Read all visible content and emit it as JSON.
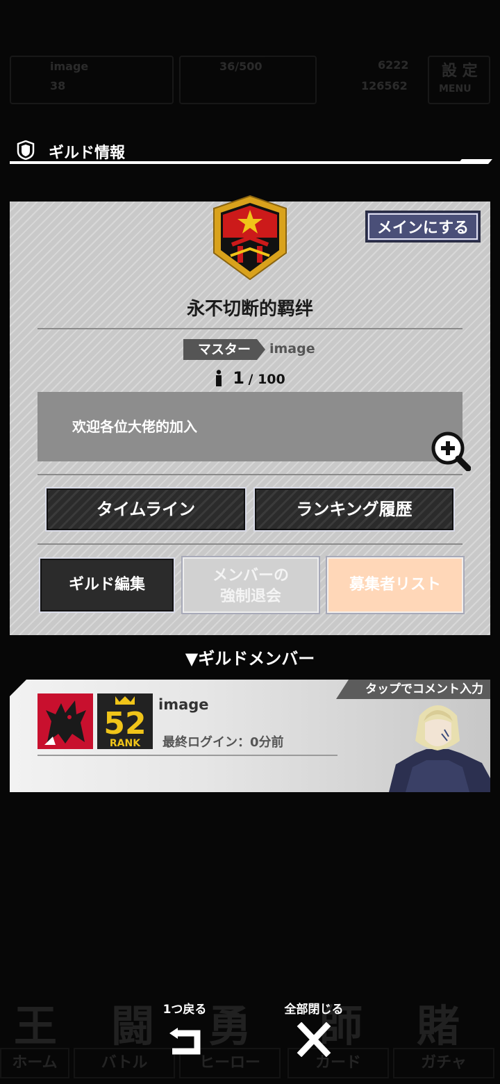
{
  "background": {
    "status_name": "image",
    "status_level": "38",
    "stamina": "36/500",
    "currency_a": "6222",
    "currency_b": "126562",
    "settings_top": "設 定",
    "settings_bottom": "MENU",
    "big_chars": [
      "王",
      "闘",
      "勇",
      "師",
      "賭"
    ],
    "tabs": [
      "ホーム",
      "バトル",
      "ヒーロー",
      "カード",
      "ガチャ"
    ]
  },
  "header": {
    "title": "ギルド情報",
    "icon": "shield-icon"
  },
  "guild": {
    "set_main_label": "メインにする",
    "name": "永不切断的羁绊",
    "master_tag": "マスター",
    "master_name": "image",
    "member_current": "1",
    "member_max": "/ 100",
    "description": "欢迎各位大佬的加入",
    "zoom_icon": "zoom-in-icon",
    "timeline_label": "タイムライン",
    "ranking_label": "ランキング履歴",
    "edit_label": "ギルド編集",
    "kick_label_line1": "メンバーの",
    "kick_label_line2": "強制退会",
    "recruit_label": "募集者リスト",
    "emblem_colors": {
      "red": "#cc1a1a",
      "gold": "#d9a21c",
      "black": "#111111"
    }
  },
  "members": {
    "title": "▼ギルドメンバー",
    "tap_comment": "タップでコメント入力",
    "list": [
      {
        "name": "image",
        "rank": "52",
        "rank_label": "RANK",
        "last_login": "最終ログイン：0分前"
      }
    ]
  },
  "controls": {
    "back_label": "1つ戻る",
    "close_all_label": "全部閉じる",
    "back_icon": "return-arrow-icon",
    "close_icon": "close-x-icon"
  }
}
